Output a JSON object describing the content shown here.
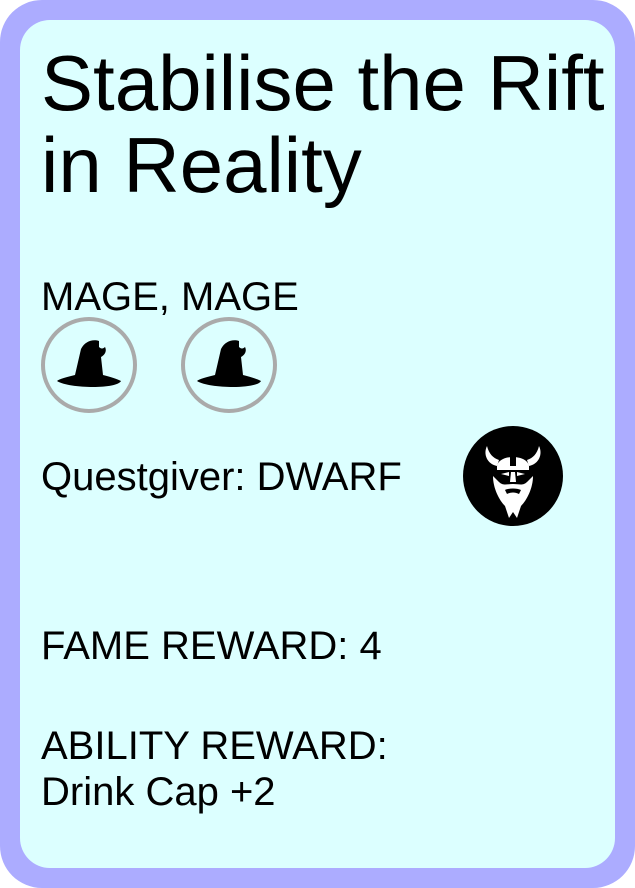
{
  "card": {
    "title_line1": "Stabilise the Rift",
    "title_line2": "in Reality",
    "party_label": "MAGE, MAGE",
    "party_icons": [
      "mage-hat-icon",
      "mage-hat-icon"
    ],
    "questgiver_label": "Questgiver: DWARF",
    "questgiver_icon": "dwarf-viking-icon",
    "fame_label": "FAME REWARD: 4",
    "ability_label": "ABILITY REWARD:",
    "ability_value": "Drink Cap +2"
  },
  "colors": {
    "border": "#acacff",
    "background": "#dcffff",
    "icon_ring": "#aaaaaa",
    "text": "#000000"
  }
}
